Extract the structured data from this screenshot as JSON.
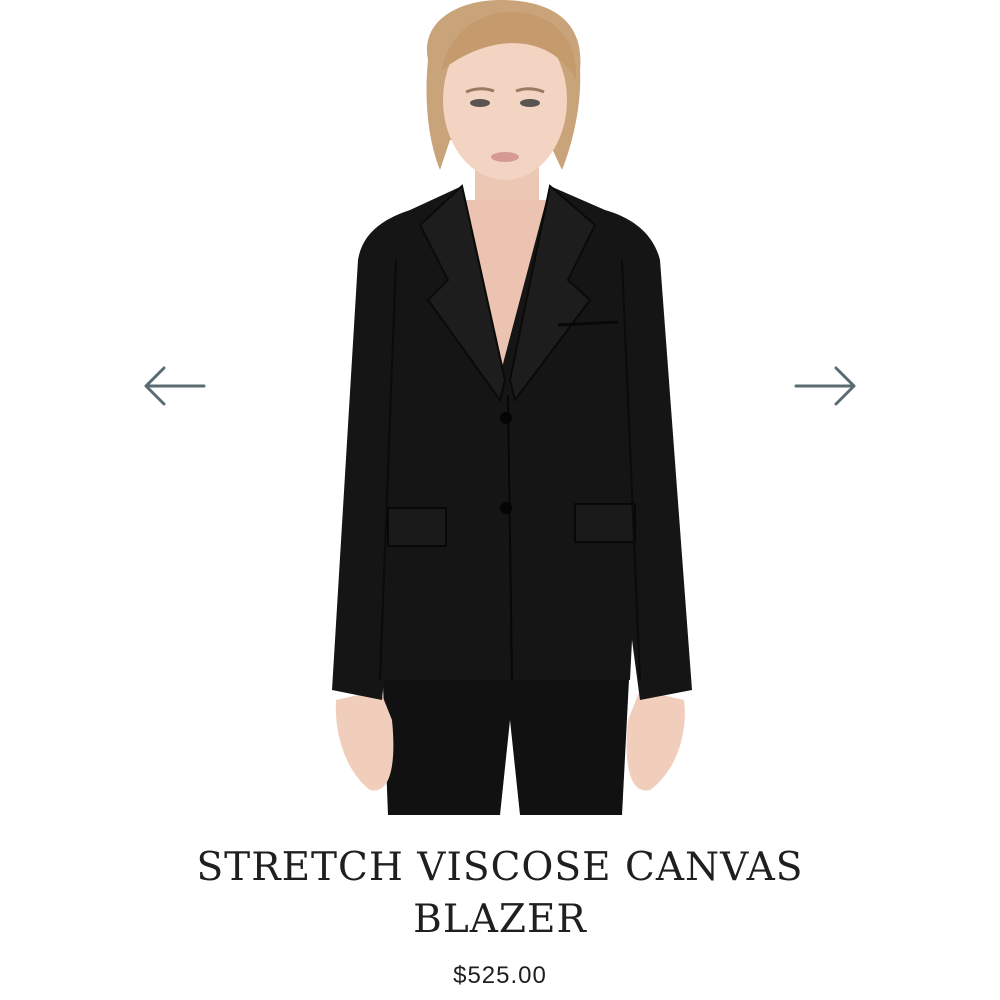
{
  "product": {
    "title_line1": "STRETCH VISCOSE CANVAS",
    "title_line2": "BLAZER",
    "price": "$525.00",
    "image_icon": "product-photo-icon"
  },
  "carousel": {
    "prev_icon": "arrow-left-icon",
    "next_icon": "arrow-right-icon",
    "arrow_color": "#5b6b73"
  },
  "colors": {
    "background": "#ffffff",
    "text": "#1f1f1f",
    "blazer": "#151515"
  }
}
